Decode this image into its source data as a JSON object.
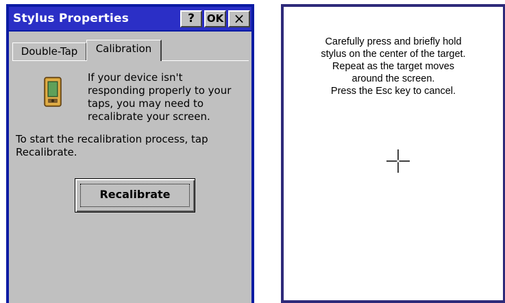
{
  "dialog": {
    "title": "Stylus Properties",
    "help_button": "?",
    "ok_button": "OK",
    "close_button": "×",
    "tabs": [
      {
        "label": "Double-Tap",
        "active": false
      },
      {
        "label": "Calibration",
        "active": true
      }
    ],
    "info_text": "If your device isn't\nresponding properly to your\ntaps, you may need to\nrecalibrate your screen.",
    "instruction_text": "To start the recalibration process, tap\nRecalibrate.",
    "recalibrate_button": "Recalibrate",
    "icon": "handheld-device-icon"
  },
  "calibration_screen": {
    "instructions": "Carefully press and briefly hold\nstylus on the center of the target.\nRepeat as the target moves\naround the screen.\nPress the Esc key to cancel.",
    "target_icon": "crosshair-target-icon"
  },
  "colors": {
    "title_bar": "#2b2fc6",
    "frame": "#0b1ba3",
    "dialog_face": "#c0c0c0",
    "calibration_border": "#2e2a7a"
  }
}
